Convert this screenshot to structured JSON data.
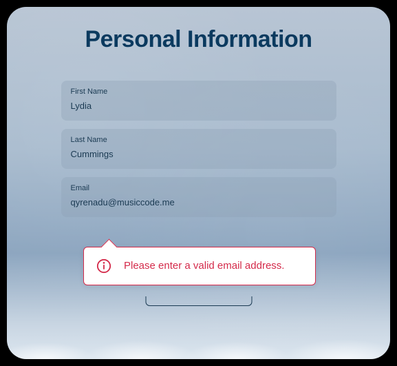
{
  "title": "Personal Information",
  "fields": {
    "first_name": {
      "label": "First Name",
      "value": "Lydia"
    },
    "last_name": {
      "label": "Last Name",
      "value": "Cummings"
    },
    "email": {
      "label": "Email",
      "value": "qyrenadu@musiccode.me"
    }
  },
  "error": {
    "message": "Please enter a valid email address."
  },
  "colors": {
    "error": "#d42a4a",
    "text_dark": "#0b3a5f"
  }
}
